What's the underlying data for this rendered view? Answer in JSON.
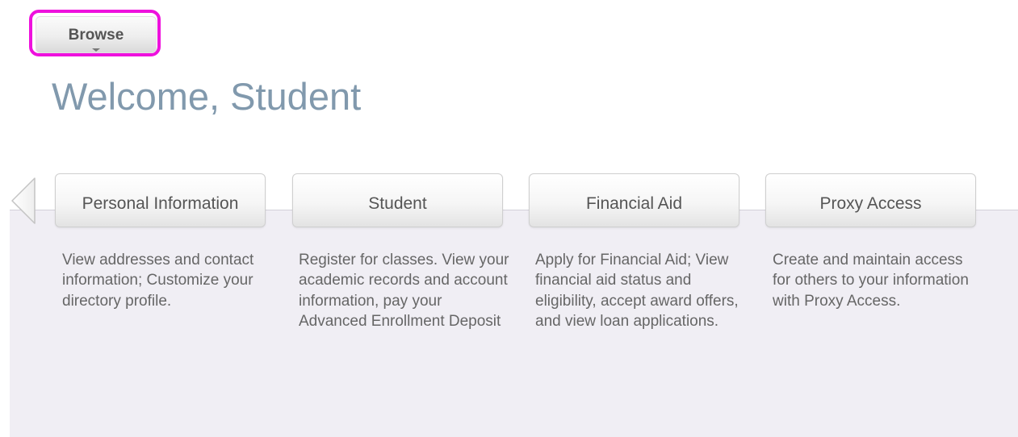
{
  "browse": {
    "label": "Browse",
    "caret_icon": "caret-down-icon"
  },
  "welcome": {
    "title": "Welcome, Student"
  },
  "colors": {
    "highlight": "#ee11dd",
    "title": "#8199ad",
    "panel": "#f0eef4"
  },
  "carousel": {
    "prev_icon": "chevron-left-icon",
    "cards": [
      {
        "title": "Personal Information",
        "description": "View addresses and contact information; Customize your directory profile."
      },
      {
        "title": "Student",
        "description": "Register for classes. View your academic records and account information, pay your Advanced Enrollment Deposit"
      },
      {
        "title": "Financial Aid",
        "description": "Apply for Financial Aid; View financial aid status and eligibility, accept award offers, and view loan applications."
      },
      {
        "title": "Proxy Access",
        "description": "Create and maintain access for others to your information with Proxy Access."
      }
    ]
  }
}
